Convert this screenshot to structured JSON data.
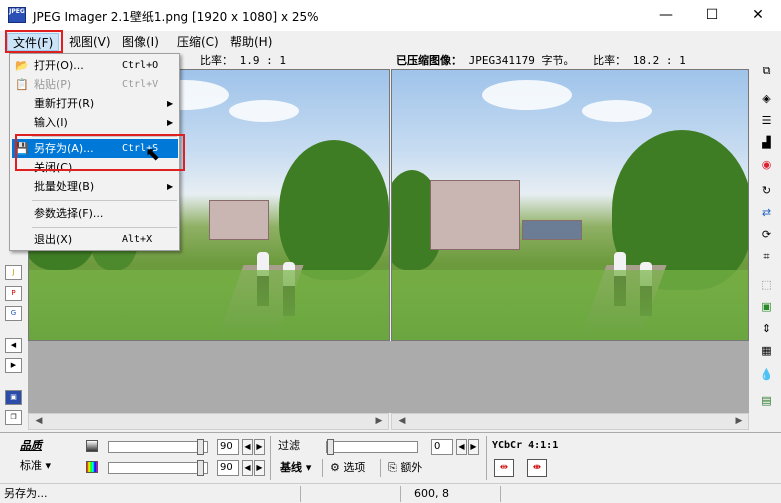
{
  "window": {
    "title": "JPEG Imager 2.1壁纸1.png [1920 x 1080] x 25%",
    "app_icon_text": "JPEG",
    "minimize_glyph": "—",
    "maximize_glyph": "☐",
    "close_glyph": "✕"
  },
  "menubar": {
    "items": [
      "文件(F)",
      "视图(V)",
      "图像(I)",
      "压缩(C)",
      "帮助(H)"
    ]
  },
  "file_menu": {
    "items": [
      {
        "label": "打开(O)...",
        "shortcut": "Ctrl+O",
        "icon": "open-folder-icon"
      },
      {
        "label": "粘贴(P)",
        "shortcut": "Ctrl+V",
        "icon": "paste-icon",
        "disabled": true
      },
      {
        "label": "重新打开(R)",
        "submenu_glyph": "▶"
      },
      {
        "label": "输入(I)",
        "submenu_glyph": "▶"
      },
      {
        "label": "另存为(A)...",
        "shortcut": "Ctrl+S",
        "icon": "save-icon",
        "highlighted": true
      },
      {
        "label": "关闭(C)"
      },
      {
        "label": "批量处理(B)",
        "submenu_glyph": "▶"
      },
      {
        "label": "参数选择(F)..."
      },
      {
        "label": "退出(X)",
        "shortcut": "Alt+X"
      }
    ]
  },
  "left_pane": {
    "ratio_label": "比率：",
    "ratio_value": "1.9 : 1"
  },
  "right_pane": {
    "header_label": "已压缩图像：",
    "header_value": "JPEG341179 字节。",
    "ratio_label": "比率：",
    "ratio_value": "18.2 : 1"
  },
  "scroll": {
    "left_arrow": "◀",
    "right_arrow": "▶"
  },
  "controls": {
    "quality_label": "品质",
    "standard_label": "标准",
    "dropdown_glyph": "▾",
    "slider1_value": "90",
    "slider2_value": "90",
    "filter_label": "过滤",
    "filter_value": "0",
    "baseline_label": "基线",
    "options_label": "选项",
    "extra_label": "额外",
    "ycbcr_label": "YCbCr 4:1:1",
    "spin_left": "◀",
    "spin_right": "▶"
  },
  "left_toolbar": {
    "icons": [
      "jpeg-icon",
      "psd-icon",
      "gif-icon",
      "back-icon",
      "forward-icon",
      "save-disk-icon",
      "copy-icon"
    ]
  },
  "right_toolbar": {
    "icons": [
      "copy-windows-icon",
      "split-icon",
      "list-icon",
      "histogram-icon",
      "color-wheel-icon",
      "rotate-icon",
      "compare-icon",
      "refresh-icon",
      "crop-icon",
      "selection-icon",
      "image-icon",
      "resize-icon",
      "tile-icon",
      "drop-icon",
      "screen-icon"
    ]
  },
  "status": {
    "message": "另存为...",
    "coords": "600, 8"
  },
  "colors": {
    "highlight": "#0078d7",
    "annotation_frame": "#e02020",
    "menu_active": "#cce4f7"
  }
}
